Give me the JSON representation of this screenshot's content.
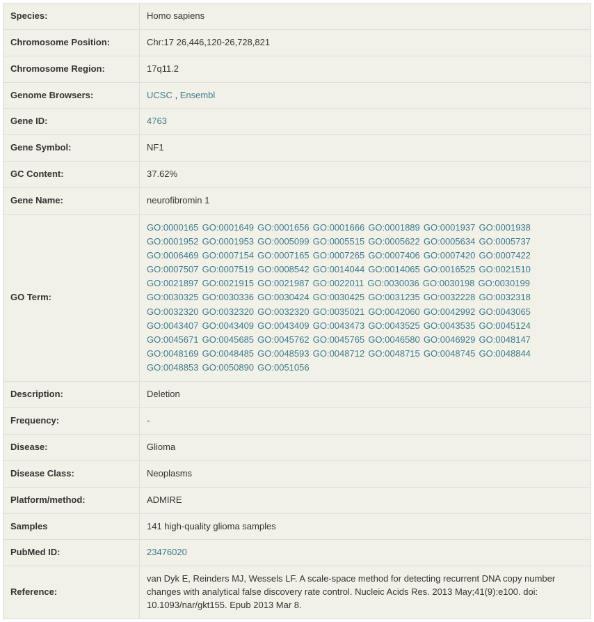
{
  "rows": {
    "species": {
      "label": "Species:",
      "value": "Homo sapiens"
    },
    "chrom_pos": {
      "label": "Chromosome Position:",
      "value": "Chr:17 26,446,120-26,728,821"
    },
    "chrom_region": {
      "label": "Chromosome Region:",
      "value": "17q11.2"
    },
    "genome_browsers": {
      "label": "Genome Browsers:",
      "link1": "UCSC",
      "link2": "Ensembl"
    },
    "gene_id": {
      "label": "Gene ID:",
      "link": "4763"
    },
    "gene_symbol": {
      "label": "Gene Symbol:",
      "value": "NF1"
    },
    "gc_content": {
      "label": "GC Content:",
      "value": "37.62%"
    },
    "gene_name": {
      "label": "Gene Name:",
      "value": "neurofibromin 1"
    },
    "go_term": {
      "label": "GO Term:"
    },
    "description": {
      "label": "Description:",
      "value": "Deletion"
    },
    "frequency": {
      "label": "Frequency:",
      "value": "-"
    },
    "disease": {
      "label": "Disease:",
      "value": "Glioma"
    },
    "disease_class": {
      "label": "Disease Class:",
      "value": "Neoplasms"
    },
    "platform": {
      "label": "Platform/method:",
      "value": "ADMIRE"
    },
    "samples": {
      "label": "Samples",
      "value": "141 high-quality glioma samples"
    },
    "pubmed": {
      "label": "PubMed ID:",
      "link": "23476020"
    },
    "reference": {
      "label": "Reference:",
      "value": "van Dyk E, Reinders MJ, Wessels LF. A scale-space method for detecting recurrent DNA copy number changes with analytical false discovery rate control. Nucleic Acids Res. 2013 May;41(9):e100. doi: 10.1093/nar/gkt155. Epub 2013 Mar 8."
    }
  },
  "go_terms": [
    "GO:0000165",
    "GO:0001649",
    "GO:0001656",
    "GO:0001666",
    "GO:0001889",
    "GO:0001937",
    "GO:0001938",
    "GO:0001952",
    "GO:0001953",
    "GO:0005099",
    "GO:0005515",
    "GO:0005622",
    "GO:0005634",
    "GO:0005737",
    "GO:0006469",
    "GO:0007154",
    "GO:0007165",
    "GO:0007265",
    "GO:0007406",
    "GO:0007420",
    "GO:0007422",
    "GO:0007507",
    "GO:0007519",
    "GO:0008542",
    "GO:0014044",
    "GO:0014065",
    "GO:0016525",
    "GO:0021510",
    "GO:0021897",
    "GO:0021915",
    "GO:0021987",
    "GO:0022011",
    "GO:0030036",
    "GO:0030198",
    "GO:0030199",
    "GO:0030325",
    "GO:0030336",
    "GO:0030424",
    "GO:0030425",
    "GO:0031235",
    "GO:0032228",
    "GO:0032318",
    "GO:0032320",
    "GO:0032320",
    "GO:0032320",
    "GO:0035021",
    "GO:0042060",
    "GO:0042992",
    "GO:0043065",
    "GO:0043407",
    "GO:0043409",
    "GO:0043409",
    "GO:0043473",
    "GO:0043525",
    "GO:0043535",
    "GO:0045124",
    "GO:0045671",
    "GO:0045685",
    "GO:0045762",
    "GO:0045765",
    "GO:0046580",
    "GO:0046929",
    "GO:0048147",
    "GO:0048169",
    "GO:0048485",
    "GO:0048593",
    "GO:0048712",
    "GO:0048715",
    "GO:0048745",
    "GO:0048844",
    "GO:0048853",
    "GO:0050890",
    "GO:0051056"
  ]
}
